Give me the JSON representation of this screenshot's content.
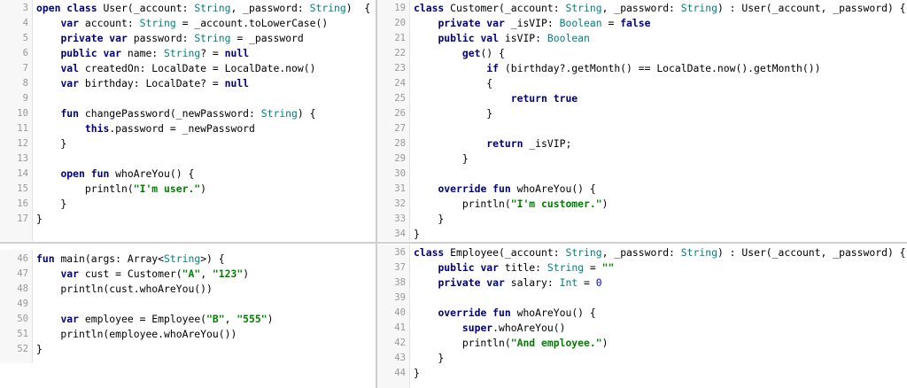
{
  "panels": [
    {
      "id": "user-class",
      "lines": [
        {
          "n": "3",
          "tokens": [
            [
              "kw",
              "open class "
            ],
            [
              "",
              "User(_account: "
            ],
            [
              "ty",
              "String"
            ],
            [
              "",
              ", _password: "
            ],
            [
              "ty",
              "String"
            ],
            [
              "",
              ")  {"
            ]
          ]
        },
        {
          "n": "4",
          "tokens": [
            [
              "",
              "    "
            ],
            [
              "kw",
              "var "
            ],
            [
              "",
              "account: "
            ],
            [
              "ty",
              "String"
            ],
            [
              "",
              " = _account.toLowerCase()"
            ]
          ]
        },
        {
          "n": "5",
          "tokens": [
            [
              "",
              "    "
            ],
            [
              "kw",
              "private var "
            ],
            [
              "",
              "password: "
            ],
            [
              "ty",
              "String"
            ],
            [
              "",
              " = _password"
            ]
          ]
        },
        {
          "n": "6",
          "tokens": [
            [
              "",
              "    "
            ],
            [
              "kw",
              "public var "
            ],
            [
              "",
              "name: "
            ],
            [
              "ty",
              "String"
            ],
            [
              "",
              "? = "
            ],
            [
              "kw",
              "null"
            ]
          ]
        },
        {
          "n": "7",
          "tokens": [
            [
              "",
              "    "
            ],
            [
              "kw",
              "val "
            ],
            [
              "",
              "createdOn: LocalDate = LocalDate.now()"
            ]
          ]
        },
        {
          "n": "8",
          "tokens": [
            [
              "",
              "    "
            ],
            [
              "kw",
              "var "
            ],
            [
              "",
              "birthday: LocalDate? = "
            ],
            [
              "kw",
              "null"
            ]
          ]
        },
        {
          "n": "9",
          "tokens": []
        },
        {
          "n": "10",
          "tokens": [
            [
              "",
              "    "
            ],
            [
              "kw",
              "fun "
            ],
            [
              "",
              "changePassword(_newPassword: "
            ],
            [
              "ty",
              "String"
            ],
            [
              "",
              ") {"
            ]
          ]
        },
        {
          "n": "11",
          "tokens": [
            [
              "",
              "        "
            ],
            [
              "kw",
              "this"
            ],
            [
              "",
              ".password = _newPassword"
            ]
          ]
        },
        {
          "n": "12",
          "tokens": [
            [
              "",
              "    }"
            ]
          ]
        },
        {
          "n": "13",
          "tokens": []
        },
        {
          "n": "14",
          "tokens": [
            [
              "",
              "    "
            ],
            [
              "kw",
              "open fun "
            ],
            [
              "",
              "whoAreYou() {"
            ]
          ]
        },
        {
          "n": "15",
          "tokens": [
            [
              "",
              "        println("
            ],
            [
              "st",
              "\"I'm user.\""
            ],
            [
              "",
              ")"
            ]
          ]
        },
        {
          "n": "16",
          "tokens": [
            [
              "",
              "    }"
            ]
          ]
        },
        {
          "n": "17",
          "tokens": [
            [
              "",
              "}"
            ]
          ]
        }
      ]
    },
    {
      "id": "customer-class",
      "lines": [
        {
          "n": "19",
          "tokens": [
            [
              "kw",
              "class "
            ],
            [
              "",
              "Customer(_account: "
            ],
            [
              "ty",
              "String"
            ],
            [
              "",
              ", _password: "
            ],
            [
              "ty",
              "String"
            ],
            [
              "",
              ") : User(_account, _password) {"
            ]
          ]
        },
        {
          "n": "20",
          "tokens": [
            [
              "",
              "    "
            ],
            [
              "kw",
              "private var "
            ],
            [
              "",
              "_isVIP: "
            ],
            [
              "ty",
              "Boolean"
            ],
            [
              "",
              " = "
            ],
            [
              "kw",
              "false"
            ]
          ]
        },
        {
          "n": "21",
          "tokens": [
            [
              "",
              "    "
            ],
            [
              "kw",
              "public val "
            ],
            [
              "",
              "isVIP: "
            ],
            [
              "ty",
              "Boolean"
            ]
          ]
        },
        {
          "n": "22",
          "tokens": [
            [
              "",
              "        "
            ],
            [
              "kw",
              "get"
            ],
            [
              "",
              "() {"
            ]
          ]
        },
        {
          "n": "23",
          "tokens": [
            [
              "",
              "            "
            ],
            [
              "kw",
              "if "
            ],
            [
              "",
              "(birthday?.getMonth() == LocalDate.now().getMonth())"
            ]
          ]
        },
        {
          "n": "24",
          "tokens": [
            [
              "",
              "            {"
            ]
          ]
        },
        {
          "n": "25",
          "tokens": [
            [
              "",
              "                "
            ],
            [
              "kw",
              "return true"
            ]
          ]
        },
        {
          "n": "26",
          "tokens": [
            [
              "",
              "            }"
            ]
          ]
        },
        {
          "n": "27",
          "tokens": []
        },
        {
          "n": "28",
          "tokens": [
            [
              "",
              "            "
            ],
            [
              "kw",
              "return "
            ],
            [
              "",
              "_isVIP;"
            ]
          ]
        },
        {
          "n": "29",
          "tokens": [
            [
              "",
              "        }"
            ]
          ]
        },
        {
          "n": "30",
          "tokens": []
        },
        {
          "n": "31",
          "tokens": [
            [
              "",
              "    "
            ],
            [
              "kw",
              "override fun "
            ],
            [
              "",
              "whoAreYou() {"
            ]
          ]
        },
        {
          "n": "32",
          "tokens": [
            [
              "",
              "        println("
            ],
            [
              "st",
              "\"I'm customer.\""
            ],
            [
              "",
              ")"
            ]
          ]
        },
        {
          "n": "33",
          "tokens": [
            [
              "",
              "    }"
            ]
          ]
        },
        {
          "n": "34",
          "tokens": [
            [
              "",
              "}"
            ]
          ]
        }
      ]
    },
    {
      "id": "main-function",
      "lines": [
        {
          "n": "46",
          "tokens": [
            [
              "kw",
              "fun "
            ],
            [
              "",
              "main(args: Array<"
            ],
            [
              "ty",
              "String"
            ],
            [
              "",
              ">) {"
            ]
          ]
        },
        {
          "n": "47",
          "tokens": [
            [
              "",
              "    "
            ],
            [
              "kw",
              "var "
            ],
            [
              "",
              "cust = Customer("
            ],
            [
              "st",
              "\"A\""
            ],
            [
              "",
              ", "
            ],
            [
              "st",
              "\"123\""
            ],
            [
              "",
              ")"
            ]
          ]
        },
        {
          "n": "48",
          "tokens": [
            [
              "",
              "    println(cust.whoAreYou())"
            ]
          ]
        },
        {
          "n": "49",
          "tokens": []
        },
        {
          "n": "50",
          "tokens": [
            [
              "",
              "    "
            ],
            [
              "kw",
              "var "
            ],
            [
              "",
              "employee = Employee("
            ],
            [
              "st",
              "\"B\""
            ],
            [
              "",
              ", "
            ],
            [
              "st",
              "\"555\""
            ],
            [
              "",
              ")"
            ]
          ]
        },
        {
          "n": "51",
          "tokens": [
            [
              "",
              "    println(employee.whoAreYou())"
            ]
          ]
        },
        {
          "n": "52",
          "tokens": [
            [
              "",
              "}"
            ]
          ]
        }
      ]
    },
    {
      "id": "employee-class",
      "lines": [
        {
          "n": "36",
          "tokens": [
            [
              "kw",
              "class "
            ],
            [
              "",
              "Employee(_account: "
            ],
            [
              "ty",
              "String"
            ],
            [
              "",
              ", _password: "
            ],
            [
              "ty",
              "String"
            ],
            [
              "",
              ") : User(_account, _password) {"
            ]
          ]
        },
        {
          "n": "37",
          "tokens": [
            [
              "",
              "    "
            ],
            [
              "kw",
              "public var "
            ],
            [
              "",
              "title: "
            ],
            [
              "ty",
              "String"
            ],
            [
              "",
              " = "
            ],
            [
              "st",
              "\"\""
            ]
          ]
        },
        {
          "n": "38",
          "tokens": [
            [
              "",
              "    "
            ],
            [
              "kw",
              "private var "
            ],
            [
              "",
              "salary: "
            ],
            [
              "ty",
              "Int"
            ],
            [
              "",
              " = "
            ],
            [
              "nu",
              "0"
            ]
          ]
        },
        {
          "n": "39",
          "tokens": []
        },
        {
          "n": "40",
          "tokens": [
            [
              "",
              "    "
            ],
            [
              "kw",
              "override fun "
            ],
            [
              "",
              "whoAreYou() {"
            ]
          ]
        },
        {
          "n": "41",
          "tokens": [
            [
              "",
              "        "
            ],
            [
              "kw",
              "super"
            ],
            [
              "",
              ".whoAreYou()"
            ]
          ]
        },
        {
          "n": "42",
          "tokens": [
            [
              "",
              "        println("
            ],
            [
              "st",
              "\"And employee.\""
            ],
            [
              "",
              ")"
            ]
          ]
        },
        {
          "n": "43",
          "tokens": [
            [
              "",
              "    }"
            ]
          ]
        },
        {
          "n": "44",
          "tokens": [
            [
              "",
              "}"
            ]
          ]
        }
      ]
    }
  ]
}
